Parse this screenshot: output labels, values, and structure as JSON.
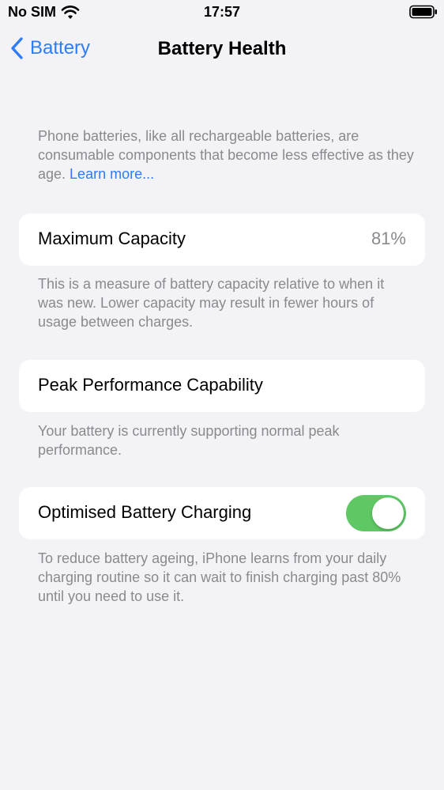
{
  "status_bar": {
    "carrier": "No SIM",
    "time": "17:57"
  },
  "nav": {
    "back_label": "Battery",
    "title": "Battery Health"
  },
  "intro": {
    "text": "Phone batteries, like all rechargeable batteries, are consumable components that become less effective as they age. ",
    "link": "Learn more..."
  },
  "maximum_capacity": {
    "label": "Maximum Capacity",
    "value": "81%",
    "footnote": "This is a measure of battery capacity relative to when it was new. Lower capacity may result in fewer hours of usage between charges."
  },
  "peak_performance": {
    "label": "Peak Performance Capability",
    "footnote": "Your battery is currently supporting normal peak performance."
  },
  "optimised_charging": {
    "label": "Optimised Battery Charging",
    "enabled": true,
    "footnote": "To reduce battery ageing, iPhone learns from your daily charging routine so it can wait to finish charging past 80% until you need to use it."
  },
  "colors": {
    "accent": "#2f7cf6",
    "toggle_on": "#5fc865",
    "background": "#f2f2f7",
    "secondary_text": "#8a8a8e"
  }
}
